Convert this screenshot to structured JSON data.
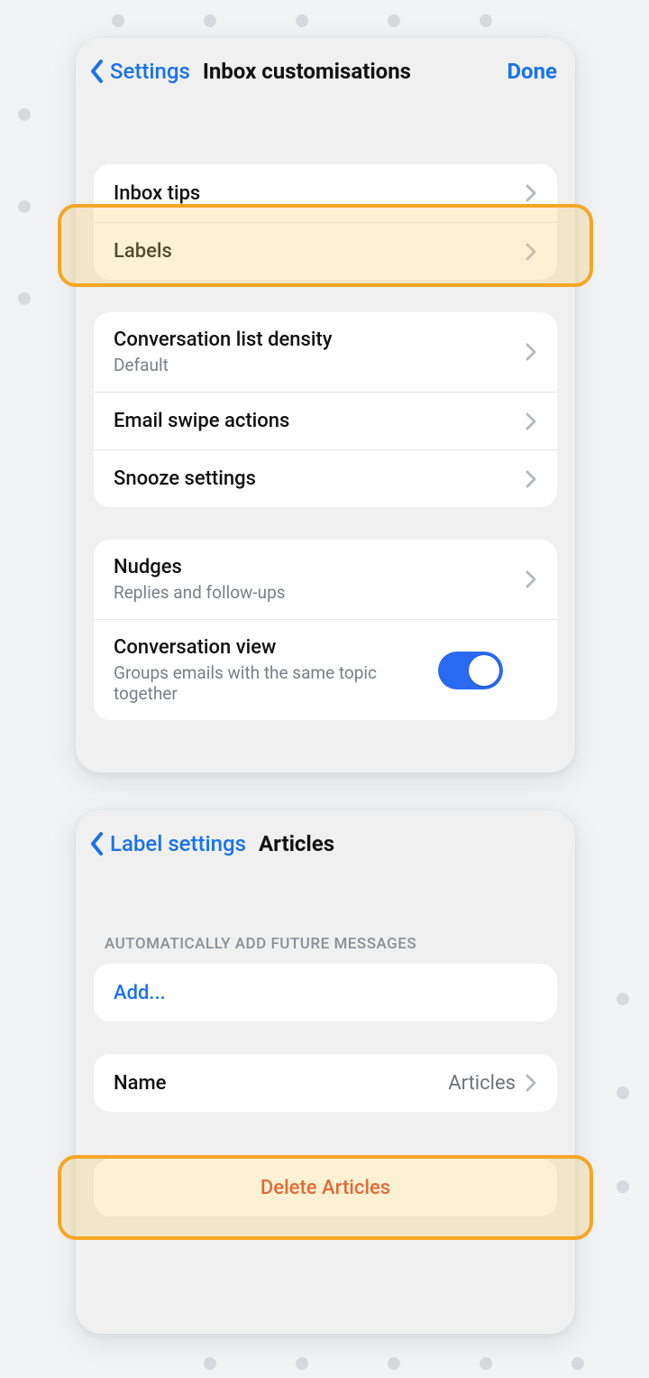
{
  "panel1": {
    "back_label": "Settings",
    "title": "Inbox customisations",
    "done_label": "Done",
    "group1": {
      "inbox_tips": "Inbox tips",
      "labels": "Labels"
    },
    "group2": {
      "density": "Conversation list density",
      "density_sub": "Default",
      "swipe": "Email swipe actions",
      "snooze": "Snooze settings"
    },
    "group3": {
      "nudges": "Nudges",
      "nudges_sub": "Replies and follow-ups",
      "conv_view": "Conversation view",
      "conv_view_sub": "Groups emails with the same topic together",
      "conv_view_on": true
    }
  },
  "panel2": {
    "back_label": "Label settings",
    "title": "Articles",
    "section_label": "AUTOMATICALLY ADD FUTURE MESSAGES",
    "add_label": "Add...",
    "name_label": "Name",
    "name_value": "Articles",
    "delete_label": "Delete Articles"
  }
}
